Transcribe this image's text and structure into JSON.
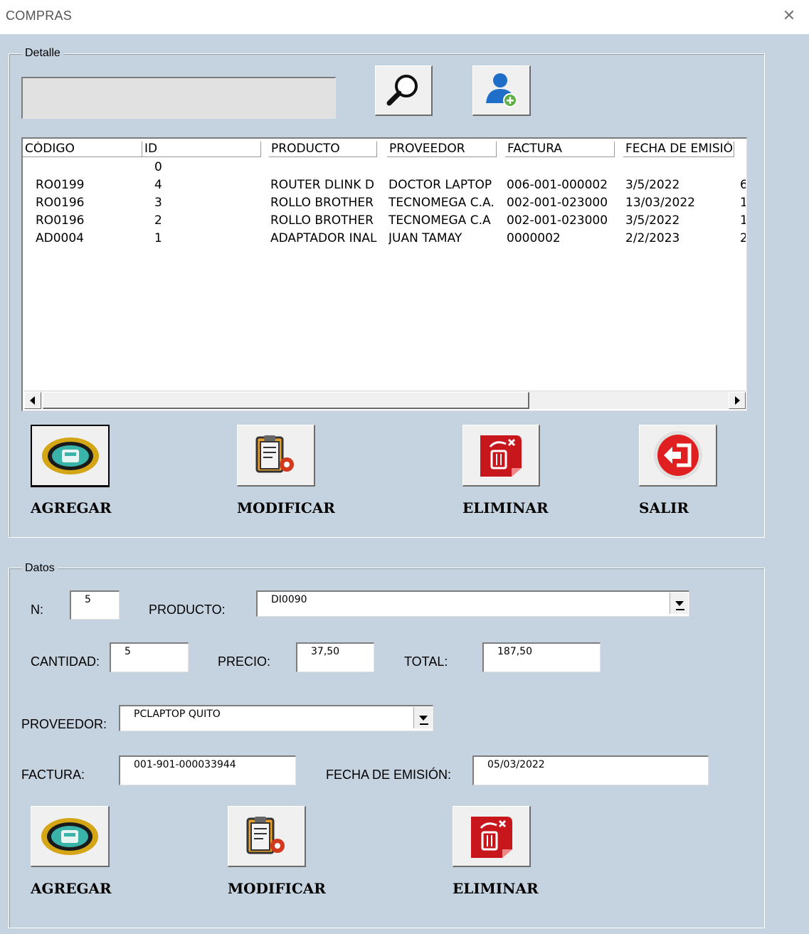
{
  "window": {
    "title": "COMPRAS",
    "close_glyph": "✕"
  },
  "detalle": {
    "legend": "Detalle",
    "search_value": "",
    "icons": {
      "search": "search-icon",
      "add_user": "add-user-icon"
    },
    "list": {
      "headers": [
        "CÓDIGO",
        "ID",
        "PRODUCTO",
        "PROVEEDOR",
        "FACTURA",
        "FECHA DE EMISIÓ"
      ],
      "rows": [
        [
          "",
          "0",
          "",
          "",
          "",
          ""
        ],
        [
          "RO0199",
          "4",
          "ROUTER DLINK D",
          "DOCTOR LAPTOP",
          "006-001-000002",
          "3/5/2022"
        ],
        [
          "RO0196",
          "3",
          "ROLLO BROTHER",
          "TECNOMEGA C.A.",
          "002-001-023000",
          "13/03/2022"
        ],
        [
          "RO0196",
          "2",
          "ROLLO BROTHER",
          "TECNOMEGA C.A",
          "002-001-023000",
          "3/5/2022"
        ],
        [
          "AD0004",
          "1",
          "ADAPTADOR INAL",
          "JUAN TAMAY",
          "0000002",
          "2/2/2023"
        ]
      ],
      "trailing": [
        "",
        "6",
        "1",
        "1",
        "2"
      ]
    },
    "buttons": {
      "agregar": "AGREGAR",
      "modificar": "MODIFICAR",
      "eliminar": "ELIMINAR",
      "salir": "SALIR"
    }
  },
  "datos": {
    "legend": "Datos",
    "n_label": "N:",
    "n_value": "5",
    "producto_label": "PRODUCTO:",
    "producto_value": "DI0090",
    "cantidad_label": "CANTIDAD:",
    "cantidad_value": "5",
    "precio_label": "PRECIO:",
    "precio_value": "37,50",
    "total_label": "TOTAL:",
    "total_value": "187,50",
    "proveedor_label": "PROVEEDOR:",
    "proveedor_value": "PCLAPTOP QUITO",
    "factura_label": "FACTURA:",
    "factura_value": "001-901-000033944",
    "fecha_label": "FECHA DE EMISIÓN:",
    "fecha_value": "05/03/2022",
    "buttons": {
      "agregar": "AGREGAR",
      "modificar": "MODIFICAR",
      "eliminar": "ELIMINAR"
    }
  },
  "colors": {
    "background": "#c5d3e1",
    "eliminar_red": "#c8161d",
    "gold": "#d4a514",
    "salir_red": "#e02020"
  }
}
